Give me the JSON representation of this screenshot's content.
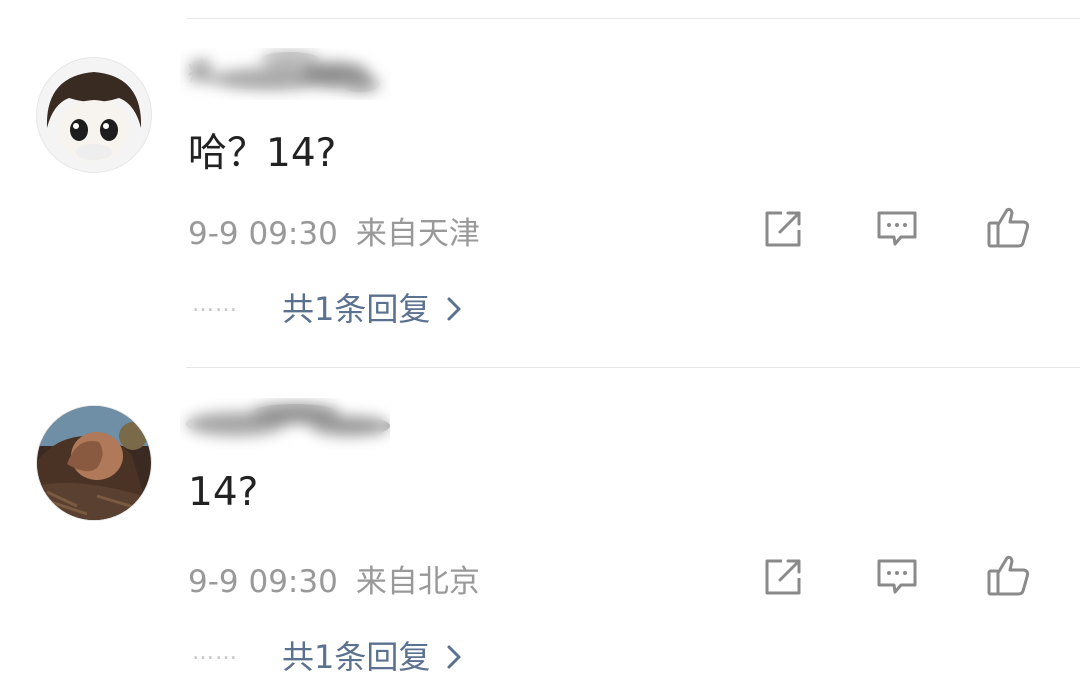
{
  "comments": [
    {
      "username": "瘋",
      "text": "哈？14?",
      "time": "9-9 09:30",
      "location": "来自天津",
      "replies_label": "共1条回复",
      "dots": "……"
    },
    {
      "username": "",
      "text": "14?",
      "time": "9-9 09:30",
      "location": "来自北京",
      "replies_label": "共1条回复",
      "dots": "……"
    }
  ],
  "icons": {
    "share": "share-icon",
    "comment": "comment-icon",
    "like": "like-icon",
    "chevron": "chevron-right-icon"
  },
  "colors": {
    "text": "#222222",
    "meta": "#999999",
    "link": "#5a7190",
    "icon": "#8a8a8a"
  }
}
